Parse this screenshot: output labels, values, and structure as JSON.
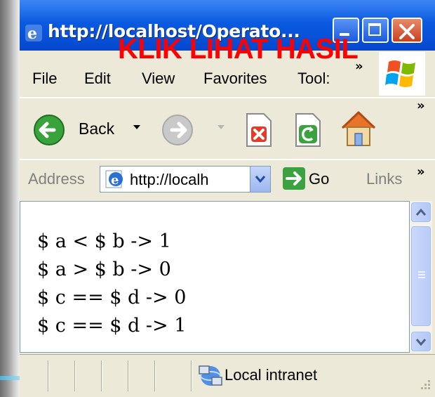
{
  "window": {
    "title": "http://localhost/Operato...",
    "overlay_caption": "KLIK LIHAT HASIL"
  },
  "menu": {
    "items": [
      "File",
      "Edit",
      "View",
      "Favorites",
      "Tool:"
    ],
    "overflow": "»"
  },
  "toolbar": {
    "back_label": "Back",
    "overflow": "»"
  },
  "address": {
    "label": "Address",
    "value": "http://localh",
    "go_label": "Go",
    "links_label": "Links",
    "overflow": "»"
  },
  "page": {
    "lines": [
      "$ a < $ b -> 1",
      "$ a > $ b -> 0",
      "$ c == $ d -> 0",
      "$ c == $ d -> 1"
    ]
  },
  "status": {
    "zone": "Local intranet"
  },
  "colors": {
    "titlebar": "#0548cf",
    "overlay_text": "#ff0000",
    "chrome": "#ece9d8"
  }
}
